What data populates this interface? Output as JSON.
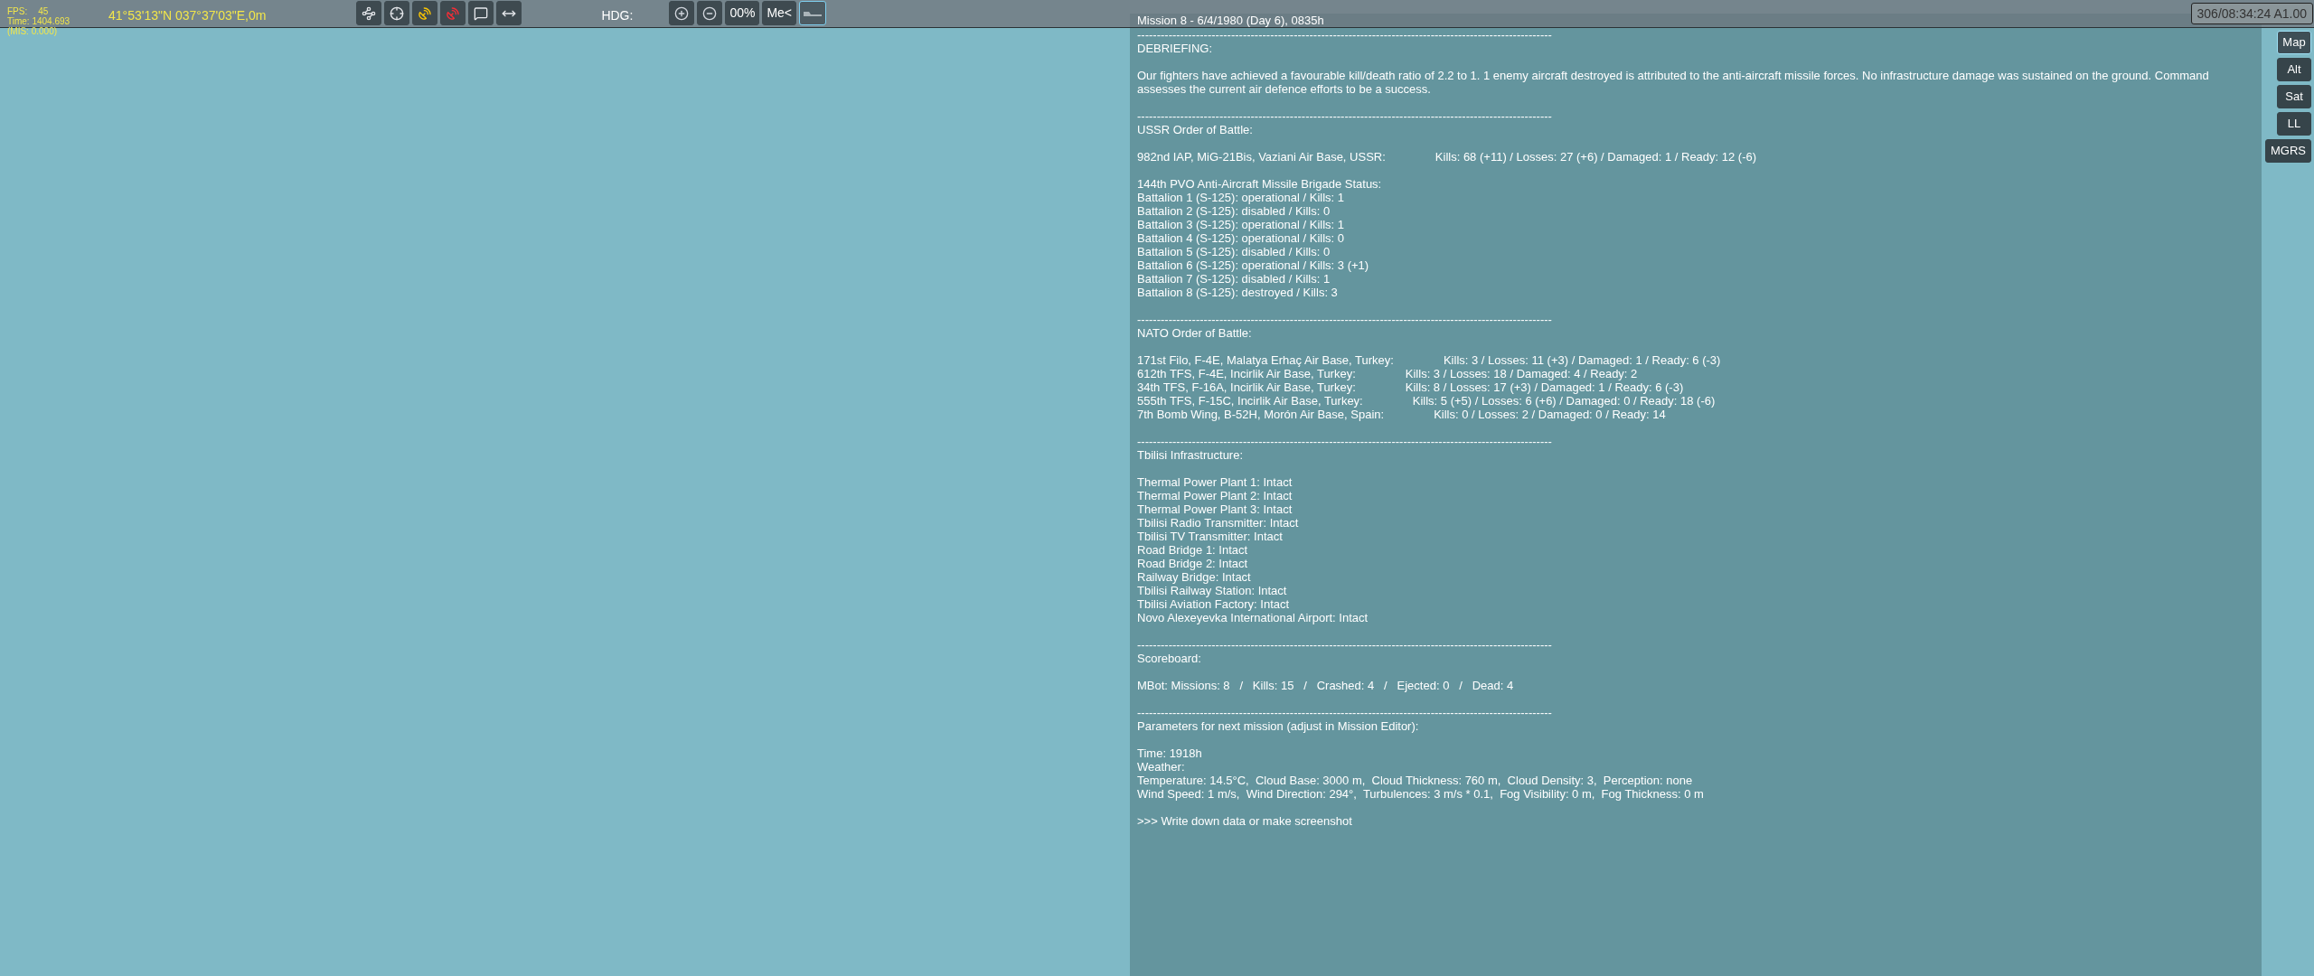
{
  "hud": {
    "fps_label": "FPS:",
    "fps": "45",
    "time": "Time: 1404.693",
    "mis": "(MIS: 0.000)",
    "coordinates": "41°53'13\"N 037°37'03\"E,0m"
  },
  "toolbar": [
    {
      "kind": "route",
      "selected": false
    },
    {
      "kind": "target",
      "selected": false
    },
    {
      "kind": "radar-yellow",
      "selected": false
    },
    {
      "kind": "radar-red",
      "selected": false
    },
    {
      "kind": "message",
      "selected": false
    },
    {
      "kind": "measure",
      "selected": false
    }
  ],
  "heading_label": "HDG:",
  "view_controls": [
    {
      "kind": "zoom-in",
      "selected": false
    },
    {
      "kind": "zoom-out",
      "selected": false
    },
    {
      "kind": "text",
      "label": "00%",
      "selected": false
    },
    {
      "kind": "text",
      "label": "Me<",
      "selected": false
    },
    {
      "kind": "terrain",
      "selected": true
    }
  ],
  "clock": "306/08:34:24 A1.00",
  "map_modes": [
    {
      "label": "Map",
      "selected": true
    },
    {
      "label": "Alt",
      "selected": false
    },
    {
      "label": "Sat",
      "selected": false
    },
    {
      "label": "LL",
      "selected": false
    },
    {
      "label": "MGRS",
      "selected": false
    }
  ],
  "report": {
    "title": "Mission 8 - 6/4/1980 (Day 6), 0835h",
    "sections": [
      {
        "divider": "----------------------------------------------------------------------------------------------------------",
        "heading": "DEBRIEFING:",
        "groups": [
          [
            {
              "text": "Our fighters have achieved a favourable kill/death ratio of 2.2 to 1. 1 enemy aircraft destroyed is attributed to the anti-aircraft missile forces. No infrastructure damage was sustained on the ground. Command assesses the current air defence efforts to be a success."
            }
          ]
        ]
      },
      {
        "divider": "----------------------------------------------------------------------------------------------------------",
        "heading": "USSR Order of Battle:",
        "groups": [
          [
            {
              "text": "982nd IAP, MiG-21Bis, Vaziani Air Base, USSR:",
              "stats": "Kills: 68 (+11) / Losses: 27 (+6) / Damaged: 1 / Ready: 12 (-6)"
            }
          ],
          [
            {
              "text": "144th PVO Anti-Aircraft Missile Brigade Status:"
            },
            {
              "text": "Battalion 1 (S-125): operational / Kills: 1"
            },
            {
              "text": "Battalion 2 (S-125): disabled / Kills: 0"
            },
            {
              "text": "Battalion 3 (S-125): operational / Kills: 1"
            },
            {
              "text": "Battalion 4 (S-125): operational / Kills: 0"
            },
            {
              "text": "Battalion 5 (S-125): disabled / Kills: 0"
            },
            {
              "text": "Battalion 6 (S-125): operational / Kills: 3 (+1)"
            },
            {
              "text": "Battalion 7 (S-125): disabled / Kills: 1"
            },
            {
              "text": "Battalion 8 (S-125): destroyed / Kills: 3"
            }
          ]
        ]
      },
      {
        "divider": "----------------------------------------------------------------------------------------------------------",
        "heading": "NATO Order of Battle:",
        "groups": [
          [
            {
              "text": "171st Filo, F-4E, Malatya Erhaç Air Base, Turkey:",
              "stats": "Kills: 3 / Losses: 11 (+3) / Damaged: 1 / Ready: 6 (-3)"
            },
            {
              "text": "612th TFS, F-4E, Incirlik Air Base, Turkey:",
              "stats": "Kills: 3 / Losses: 18 / Damaged: 4 / Ready: 2"
            },
            {
              "text": "34th TFS, F-16A, Incirlik Air Base, Turkey:",
              "stats": "Kills: 8 / Losses: 17 (+3) / Damaged: 1 / Ready: 6 (-3)"
            },
            {
              "text": "555th TFS, F-15C, Incirlik Air Base, Turkey:",
              "stats": "Kills: 5 (+5) / Losses: 6 (+6) / Damaged: 0 / Ready: 18 (-6)"
            },
            {
              "text": "7th Bomb Wing, B-52H, Morón Air Base, Spain:",
              "stats": "Kills: 0 / Losses: 2 / Damaged: 0 / Ready: 14"
            }
          ]
        ]
      },
      {
        "divider": "----------------------------------------------------------------------------------------------------------",
        "heading": "Tbilisi Infrastructure:",
        "groups": [
          [
            {
              "text": "Thermal Power Plant 1: Intact"
            },
            {
              "text": "Thermal Power Plant 2: Intact"
            },
            {
              "text": "Thermal Power Plant 3: Intact"
            },
            {
              "text": "Tbilisi Radio Transmitter: Intact"
            },
            {
              "text": "Tbilisi TV Transmitter: Intact"
            },
            {
              "text": "Road Bridge 1: Intact"
            },
            {
              "text": "Road Bridge 2: Intact"
            },
            {
              "text": "Railway Bridge: Intact"
            },
            {
              "text": "Tbilisi Railway Station: Intact"
            },
            {
              "text": "Tbilisi Aviation Factory: Intact"
            },
            {
              "text": "Novo Alexeyevka International Airport: Intact"
            }
          ]
        ]
      },
      {
        "divider": "----------------------------------------------------------------------------------------------------------",
        "heading": "Scoreboard:",
        "groups": [
          [
            {
              "text": "MBot: Missions: 8   /   Kills: 15   /   Crashed: 4   /   Ejected: 0   /   Dead: 4"
            }
          ]
        ]
      },
      {
        "divider": "----------------------------------------------------------------------------------------------------------",
        "heading": "Parameters for next mission (adjust in Mission Editor):",
        "groups": [
          [
            {
              "text": "Time: 1918h"
            },
            {
              "text": "Weather:"
            },
            {
              "text": "Temperature: 14.5°C,  Cloud Base: 3000 m,  Cloud Thickness: 760 m,  Cloud Density: 3,  Perception: none"
            },
            {
              "text": "Wind Speed: 1 m/s,  Wind Direction: 294°,  Turbulences: 3 m/s * 0.1,  Fog Visibility: 0 m,  Fog Thickness: 0 m"
            }
          ],
          [
            {
              "text": ">>> Write down data or make screenshot"
            }
          ]
        ]
      }
    ]
  }
}
